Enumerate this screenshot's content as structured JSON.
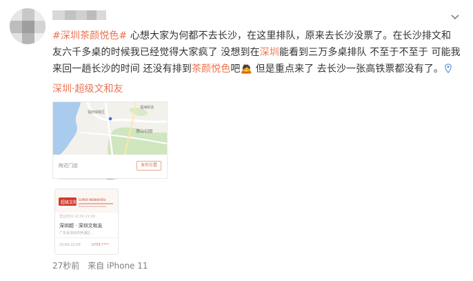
{
  "post": {
    "text_parts": {
      "topic_1": "#深圳茶颜悦色#",
      "t1": " 心想大家为何都不去长沙，在这里排队，原来去长沙没票了。在长沙排文和友六千多桌的时候我已经觉得大家疯了 没想到在",
      "kw_1": "深圳",
      "t2": "能看到三万多桌排队 不至于不至于 可能我来回一趟长沙的时间 还没有排到",
      "kw_2": "茶颜悦色",
      "t3": "吧",
      "emoji": "🙇",
      "t4": "  但是重点来了 去长沙一张高铁票都没有了。"
    },
    "location": {
      "city": "深圳",
      "separator": "·",
      "place": "超级文和友"
    }
  },
  "map_card": {
    "store_label": "附近门店",
    "button_label": "发布位置",
    "labels": {
      "road_1": "福田保税区",
      "road_2": "福海街道",
      "area_1": "莲山公园"
    }
  },
  "store_card": {
    "sign_text": "SUPER WENHEYOU",
    "sign_main": "超级文和友",
    "sub": "营业时间 10:00-22:00",
    "name": "深圳超 · 深圳文和友",
    "address": "广东省深圳市罗湖区...",
    "hours": "10:00-22:00",
    "phone": "0755-****"
  },
  "meta": {
    "time": "27秒前",
    "source": "来自 iPhone 11"
  },
  "colors": {
    "link": "#eb7350",
    "meta": "#808080",
    "text": "#333333"
  }
}
